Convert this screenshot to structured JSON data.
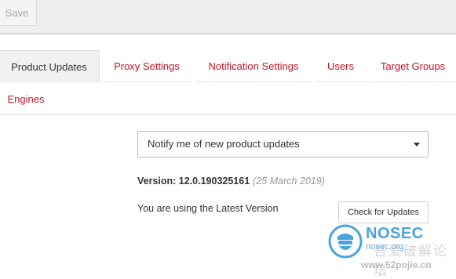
{
  "toolbar": {
    "save_label": "Save"
  },
  "tabs": [
    {
      "label": "Product Updates",
      "active": true
    },
    {
      "label": "Proxy Settings",
      "active": false
    },
    {
      "label": "Notification Settings",
      "active": false
    },
    {
      "label": "Users",
      "active": false
    },
    {
      "label": "Target Groups",
      "active": false
    },
    {
      "label": "Engines",
      "active": false
    }
  ],
  "updates": {
    "select_value": "Notify me of new product updates",
    "version_label": "Version: 12.0.190325161",
    "version_date": "(25 March 2019)",
    "status_text": "You are using the Latest Version",
    "check_button_label": "Check for Updates"
  },
  "watermark": {
    "title": "NOSEC",
    "subtitle": "nosec.org",
    "chinese_text": "吾爱破解论坛",
    "url": "www.52pojie.cn"
  },
  "colors": {
    "accent": "#c41526",
    "watermark_blue": "#4aa3df"
  }
}
